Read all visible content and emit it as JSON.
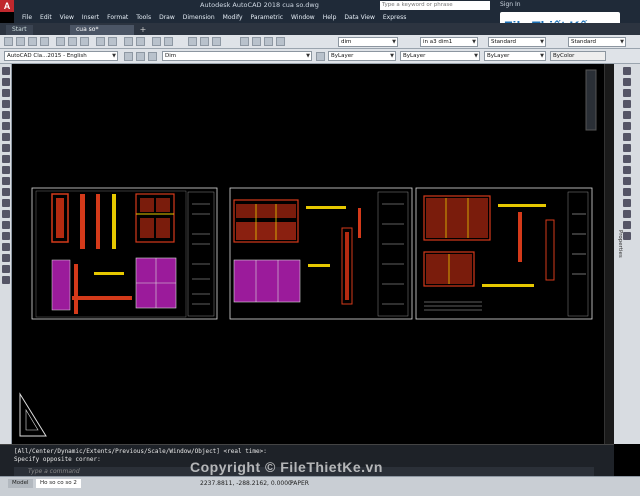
{
  "window": {
    "title": "Autodesk AutoCAD 2018   cua so.dwg",
    "search_placeholder": "Type a keyword or phrase",
    "sign_in": "Sign In",
    "app_logo": "A"
  },
  "brand": {
    "text": "File Thiết Kế.vn"
  },
  "menu": [
    "File",
    "Edit",
    "View",
    "Insert",
    "Format",
    "Tools",
    "Draw",
    "Dimension",
    "Modify",
    "Parametric",
    "Window",
    "Help",
    "Data View",
    "Express"
  ],
  "tabs": {
    "start": "Start",
    "drawing": "cua so*",
    "add": "+"
  },
  "toolbar": {
    "dimstyle": "dim",
    "textstyle": "in a3 dim1",
    "tablestyle": "Standard",
    "mleaderstyle": "Standard",
    "workspace": "AutoCAD Cla...2015 - English",
    "layer": "Dim",
    "color": "ByLayer",
    "linetype": "ByLayer",
    "lineweight": "ByLayer",
    "plotstyle": "ByColor"
  },
  "side_panel": {
    "label": "Properties"
  },
  "command": {
    "history_1": "[All/Center/Dynamic/Extents/Previous/Scale/Window/Object] <real time>:",
    "history_2": "Specify opposite corner:",
    "placeholder": "Type  a  command"
  },
  "status": {
    "tabs": [
      "Model",
      "Ho so co so 2"
    ],
    "coords": "2237.8811, -288.2162, 0.0000",
    "paper": "PAPER"
  },
  "watermark": "Copyright © FileThietKe.vn",
  "colors": {
    "accent": "#c0282d",
    "drawing_red": "#d43a1a",
    "drawing_magenta": "#b020b0",
    "drawing_yellow": "#e6c800"
  }
}
